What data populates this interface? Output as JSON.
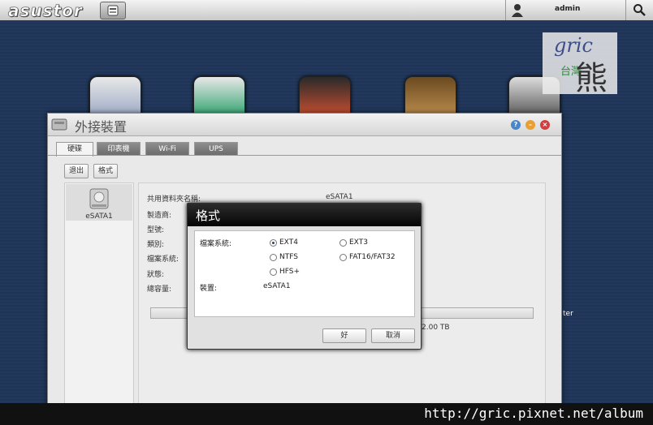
{
  "topbar": {
    "logo": "asustor",
    "user": "admin"
  },
  "watermark": {
    "line1": "gric",
    "line2": "台灣",
    "line3": "熊"
  },
  "window": {
    "title": "外接裝置",
    "tabs": [
      "硬碟",
      "印表機",
      "Wi-Fi",
      "UPS"
    ],
    "buttons": {
      "eject": "退出",
      "format": "格式"
    },
    "drive": {
      "name": "eSATA1"
    },
    "details": {
      "share_name_label": "共用資料夾名稱:",
      "share_name_value": "eSATA1",
      "maker_label": "製造商:",
      "model_label": "型號:",
      "type_label": "類別:",
      "fs_label": "檔案系統:",
      "status_label": "狀態:",
      "capacity_label": "總容量:",
      "capacity_value": "2.00 TB"
    }
  },
  "desktop_partial_text": "ter",
  "dialog": {
    "title": "格式",
    "fs_label": "檔案系統:",
    "options": [
      "EXT4",
      "EXT3",
      "NTFS",
      "FAT16/FAT32",
      "HFS+"
    ],
    "selected": "EXT4",
    "device_label": "裝置:",
    "device_value": "eSATA1",
    "ok": "好",
    "cancel": "取消"
  },
  "footer": {
    "url": "http://gric.pixnet.net/album"
  }
}
